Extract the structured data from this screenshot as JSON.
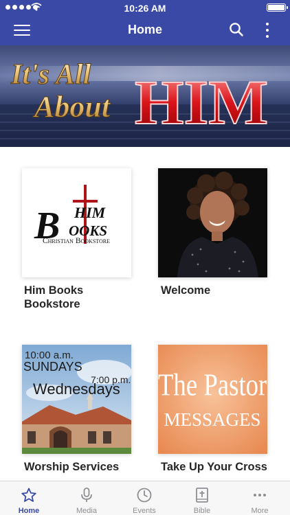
{
  "status_bar": {
    "time": "10:26 AM"
  },
  "header": {
    "title": "Home"
  },
  "banner": {
    "line1": "It's All",
    "line2": "About",
    "line3": "HIM"
  },
  "himbooks_logo": {
    "big": "B",
    "top": "HIM",
    "mid": "OOKS",
    "bottom": "Christian Bookstore"
  },
  "worship_tile": {
    "line1": "10:00 a.m.",
    "line2": "SUNDAYS",
    "line3": "7:00 p.m.",
    "line4": "Wednesdays"
  },
  "pastor_tile": {
    "line1": "The Pastor",
    "line2": "MESSAGES"
  },
  "grid": [
    {
      "label": "Him Books Bookstore"
    },
    {
      "label": "Welcome"
    },
    {
      "label": "Worship Services"
    },
    {
      "label": "Take Up Your Cross"
    }
  ],
  "tabs": [
    {
      "label": "Home",
      "icon": "star-icon"
    },
    {
      "label": "Media",
      "icon": "microphone-icon"
    },
    {
      "label": "Events",
      "icon": "clock-icon"
    },
    {
      "label": "Bible",
      "icon": "bible-icon"
    },
    {
      "label": "More",
      "icon": "more-dots-icon"
    }
  ],
  "colors": {
    "brand": "#3a49a6",
    "tab_inactive": "#8e8e93",
    "pastor_bg": "#f2a26e",
    "welcome_bg": "#0c0c0c"
  }
}
